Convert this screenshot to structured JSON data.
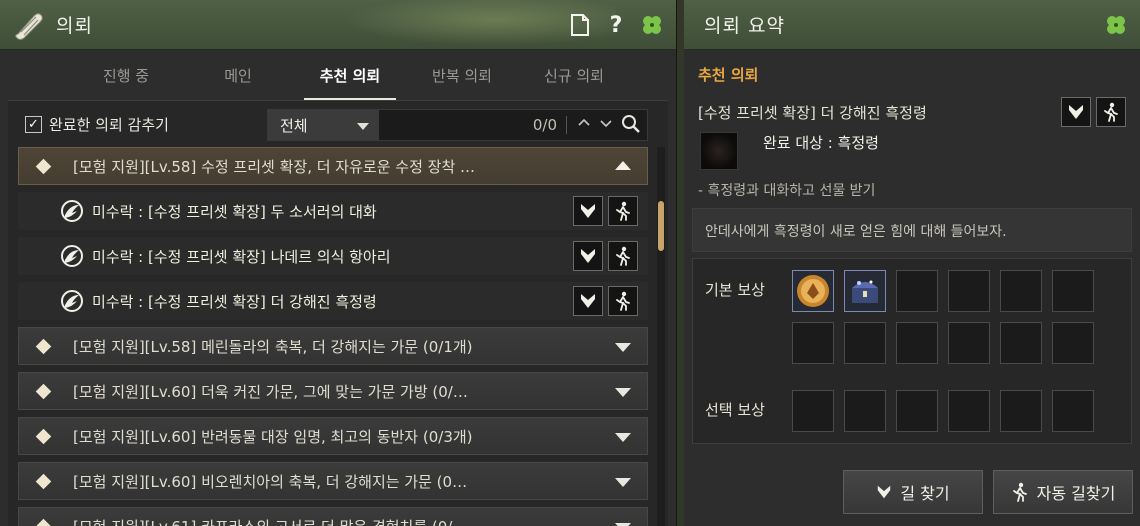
{
  "left": {
    "title": "의뢰",
    "tabs": [
      {
        "label": "진행 중"
      },
      {
        "label": "메인"
      },
      {
        "label": "추천 의뢰",
        "active": true
      },
      {
        "label": "반복 의뢰"
      },
      {
        "label": "신규 의뢰"
      }
    ],
    "filter": {
      "hide_completed_label": "완료한 의뢰 감추기",
      "hide_completed_checked": true,
      "dropdown_value": "전체",
      "counter": "0/0"
    },
    "quests": [
      {
        "text": "[모험 지원][Lv.58] 수정 프리셋 확장, 더 자유로운 수정 장착 …",
        "open": true,
        "subs": [
          {
            "text": "미수락 : [수정 프리셋 확장] 두 소서러의 대화"
          },
          {
            "text": "미수락 : [수정 프리셋 확장] 나데르 의식 항아리"
          },
          {
            "text": "미수락 : [수정 프리셋 확장] 더 강해진 흑정령"
          }
        ]
      },
      {
        "text": "[모험 지원][Lv.58] 메린돌라의 축복, 더 강해지는 가문 (0/1개)",
        "open": false
      },
      {
        "text": "[모험 지원][Lv.60] 더욱 커진 가문, 그에 맞는 가문 가방 (0/…",
        "open": false
      },
      {
        "text": "[모험 지원][Lv.60] 반려동물 대장 임명, 최고의 동반자 (0/3개)",
        "open": false
      },
      {
        "text": "[모험 지원][Lv.60] 비오렌치아의 축복, 더 강해지는 가문 (0…",
        "open": false
      },
      {
        "text": "[모험 지원][Lv.61] 카프라스의 고서로 더 많은 경험치를 (0/…",
        "open": false
      }
    ]
  },
  "right": {
    "title": "의뢰 요약",
    "section": "추천 의뢰",
    "quest_title": "[수정 프리셋 확장] 더 강해진 흑정령",
    "target": "완료 대상 : 흑정령",
    "objective": "- 흑정령과 대화하고 선물 받기",
    "description": "안데사에게 흑정령이 새로 얻은 힘에 대해 들어보자.",
    "basic_reward_label": "기본 보상",
    "select_reward_label": "선택 보상",
    "find_path_label": "길 찾기",
    "auto_path_label": "자동 길찾기"
  },
  "colors": {
    "accent": "#e8a840",
    "titlebar": "#4a5a40",
    "scroll_thumb": "#c9a46a"
  },
  "icons": [
    "scroll-icon",
    "document-icon",
    "help-icon",
    "clover-icon",
    "search-icon",
    "waypoint-icon",
    "auto-walk-icon",
    "black-spirit-icon",
    "gold-medal-icon",
    "treasure-chest-icon"
  ]
}
